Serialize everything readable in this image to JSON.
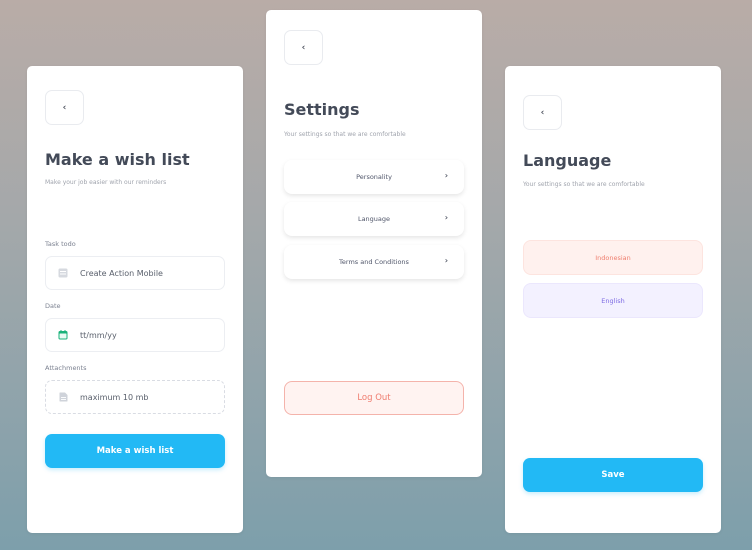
{
  "colors": {
    "accent": "#22b9f5",
    "danger": "#ef7c6f",
    "danger_bg": "#fff3f1",
    "indonesian_bg": "#fff1ee",
    "english_bg": "#f3f1ff",
    "english_text": "#7d6be3",
    "date_icon": "#19b27a"
  },
  "wishlist": {
    "back_icon": "‹",
    "title": "Make a wish list",
    "subtitle": "Make your job easier with our reminders",
    "task_label": "Task todo",
    "task_value": "Create Action Mobile",
    "task_icon": "list-icon",
    "date_label": "Date",
    "date_placeholder": "tt/mm/yy",
    "date_icon": "calendar-icon",
    "attachments_label": "Attachments",
    "attachments_placeholder": "maximum 10 mb",
    "attachments_icon": "file-icon",
    "submit_label": "Make a wish list"
  },
  "settings": {
    "back_icon": "‹",
    "title": "Settings",
    "subtitle": "Your settings so that we are comfortable",
    "items": [
      {
        "label": "Personality",
        "chevron": "›"
      },
      {
        "label": "Language",
        "chevron": "›"
      },
      {
        "label": "Terms and Conditions",
        "chevron": "›"
      }
    ],
    "logout_label": "Log Out"
  },
  "language": {
    "back_icon": "‹",
    "title": "Language",
    "subtitle": "Your settings so that we are comfortable",
    "options": [
      {
        "label": "Indonesian"
      },
      {
        "label": "English"
      }
    ],
    "save_label": "Save"
  }
}
